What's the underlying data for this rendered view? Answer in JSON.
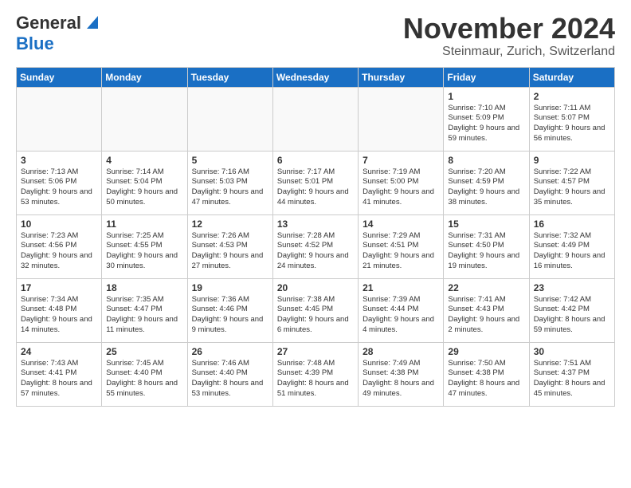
{
  "header": {
    "logo_line1": "General",
    "logo_line2": "Blue",
    "month_title": "November 2024",
    "location": "Steinmaur, Zurich, Switzerland"
  },
  "weekdays": [
    "Sunday",
    "Monday",
    "Tuesday",
    "Wednesday",
    "Thursday",
    "Friday",
    "Saturday"
  ],
  "weeks": [
    [
      {
        "day": "",
        "text": ""
      },
      {
        "day": "",
        "text": ""
      },
      {
        "day": "",
        "text": ""
      },
      {
        "day": "",
        "text": ""
      },
      {
        "day": "",
        "text": ""
      },
      {
        "day": "1",
        "text": "Sunrise: 7:10 AM\nSunset: 5:09 PM\nDaylight: 9 hours and 59 minutes."
      },
      {
        "day": "2",
        "text": "Sunrise: 7:11 AM\nSunset: 5:07 PM\nDaylight: 9 hours and 56 minutes."
      }
    ],
    [
      {
        "day": "3",
        "text": "Sunrise: 7:13 AM\nSunset: 5:06 PM\nDaylight: 9 hours and 53 minutes."
      },
      {
        "day": "4",
        "text": "Sunrise: 7:14 AM\nSunset: 5:04 PM\nDaylight: 9 hours and 50 minutes."
      },
      {
        "day": "5",
        "text": "Sunrise: 7:16 AM\nSunset: 5:03 PM\nDaylight: 9 hours and 47 minutes."
      },
      {
        "day": "6",
        "text": "Sunrise: 7:17 AM\nSunset: 5:01 PM\nDaylight: 9 hours and 44 minutes."
      },
      {
        "day": "7",
        "text": "Sunrise: 7:19 AM\nSunset: 5:00 PM\nDaylight: 9 hours and 41 minutes."
      },
      {
        "day": "8",
        "text": "Sunrise: 7:20 AM\nSunset: 4:59 PM\nDaylight: 9 hours and 38 minutes."
      },
      {
        "day": "9",
        "text": "Sunrise: 7:22 AM\nSunset: 4:57 PM\nDaylight: 9 hours and 35 minutes."
      }
    ],
    [
      {
        "day": "10",
        "text": "Sunrise: 7:23 AM\nSunset: 4:56 PM\nDaylight: 9 hours and 32 minutes."
      },
      {
        "day": "11",
        "text": "Sunrise: 7:25 AM\nSunset: 4:55 PM\nDaylight: 9 hours and 30 minutes."
      },
      {
        "day": "12",
        "text": "Sunrise: 7:26 AM\nSunset: 4:53 PM\nDaylight: 9 hours and 27 minutes."
      },
      {
        "day": "13",
        "text": "Sunrise: 7:28 AM\nSunset: 4:52 PM\nDaylight: 9 hours and 24 minutes."
      },
      {
        "day": "14",
        "text": "Sunrise: 7:29 AM\nSunset: 4:51 PM\nDaylight: 9 hours and 21 minutes."
      },
      {
        "day": "15",
        "text": "Sunrise: 7:31 AM\nSunset: 4:50 PM\nDaylight: 9 hours and 19 minutes."
      },
      {
        "day": "16",
        "text": "Sunrise: 7:32 AM\nSunset: 4:49 PM\nDaylight: 9 hours and 16 minutes."
      }
    ],
    [
      {
        "day": "17",
        "text": "Sunrise: 7:34 AM\nSunset: 4:48 PM\nDaylight: 9 hours and 14 minutes."
      },
      {
        "day": "18",
        "text": "Sunrise: 7:35 AM\nSunset: 4:47 PM\nDaylight: 9 hours and 11 minutes."
      },
      {
        "day": "19",
        "text": "Sunrise: 7:36 AM\nSunset: 4:46 PM\nDaylight: 9 hours and 9 minutes."
      },
      {
        "day": "20",
        "text": "Sunrise: 7:38 AM\nSunset: 4:45 PM\nDaylight: 9 hours and 6 minutes."
      },
      {
        "day": "21",
        "text": "Sunrise: 7:39 AM\nSunset: 4:44 PM\nDaylight: 9 hours and 4 minutes."
      },
      {
        "day": "22",
        "text": "Sunrise: 7:41 AM\nSunset: 4:43 PM\nDaylight: 9 hours and 2 minutes."
      },
      {
        "day": "23",
        "text": "Sunrise: 7:42 AM\nSunset: 4:42 PM\nDaylight: 8 hours and 59 minutes."
      }
    ],
    [
      {
        "day": "24",
        "text": "Sunrise: 7:43 AM\nSunset: 4:41 PM\nDaylight: 8 hours and 57 minutes."
      },
      {
        "day": "25",
        "text": "Sunrise: 7:45 AM\nSunset: 4:40 PM\nDaylight: 8 hours and 55 minutes."
      },
      {
        "day": "26",
        "text": "Sunrise: 7:46 AM\nSunset: 4:40 PM\nDaylight: 8 hours and 53 minutes."
      },
      {
        "day": "27",
        "text": "Sunrise: 7:48 AM\nSunset: 4:39 PM\nDaylight: 8 hours and 51 minutes."
      },
      {
        "day": "28",
        "text": "Sunrise: 7:49 AM\nSunset: 4:38 PM\nDaylight: 8 hours and 49 minutes."
      },
      {
        "day": "29",
        "text": "Sunrise: 7:50 AM\nSunset: 4:38 PM\nDaylight: 8 hours and 47 minutes."
      },
      {
        "day": "30",
        "text": "Sunrise: 7:51 AM\nSunset: 4:37 PM\nDaylight: 8 hours and 45 minutes."
      }
    ]
  ]
}
